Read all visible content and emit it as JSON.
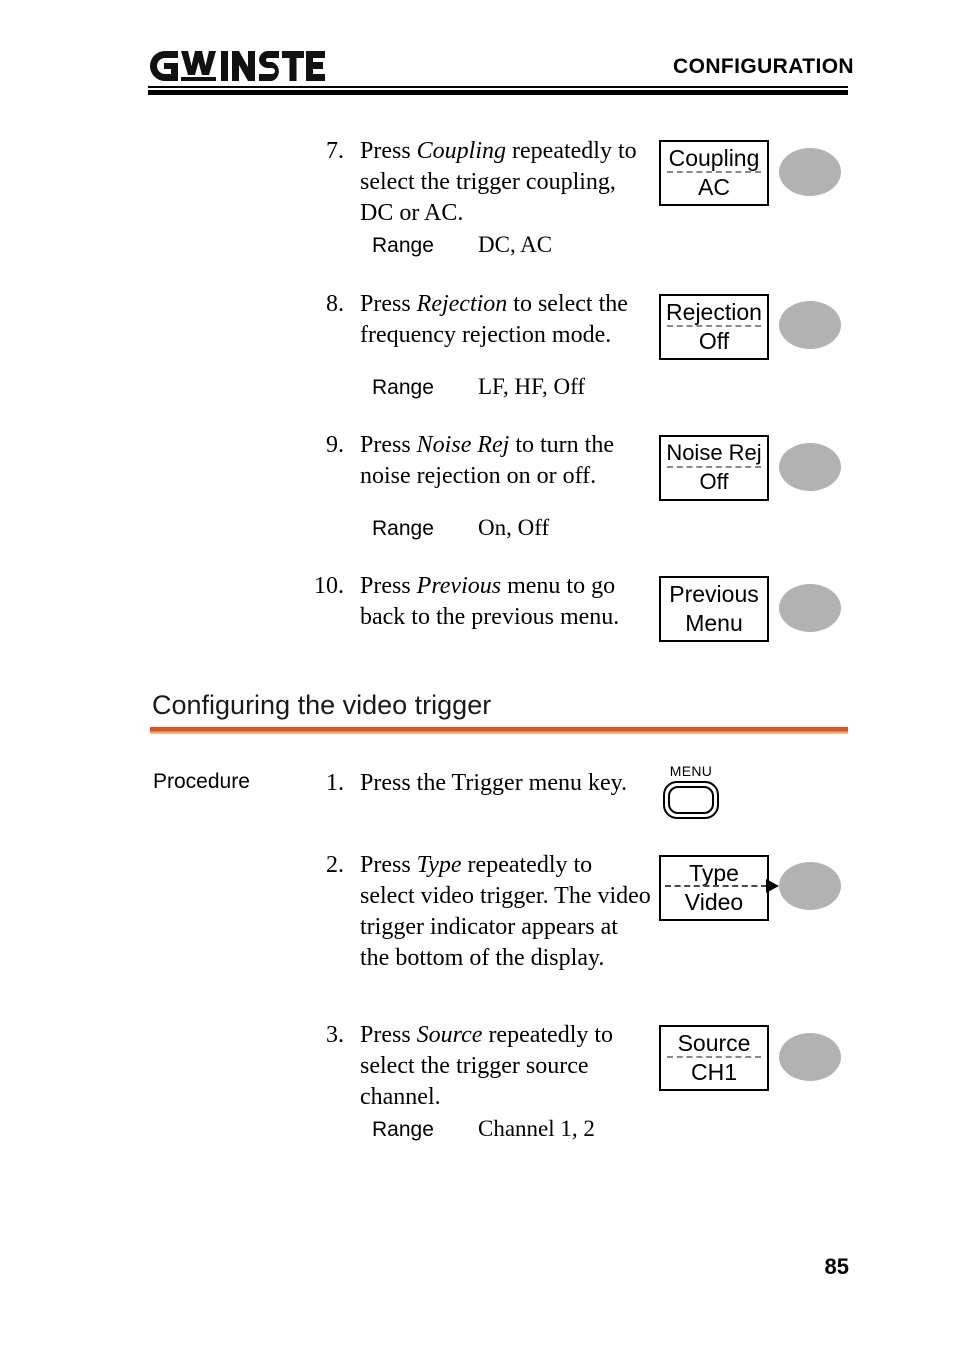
{
  "header": {
    "logo_text": "GW INSTEK",
    "title": "CONFIGURATION"
  },
  "steps": [
    {
      "number": "7.",
      "text_parts": [
        "Press ",
        "Coupling",
        " repeatedly to select the trigger coupling, DC or AC."
      ],
      "range_label": "Range",
      "range_value": "DC, AC",
      "softkey": {
        "top": "Coupling",
        "bottom": "AC",
        "separator": "dotted"
      }
    },
    {
      "number": "8.",
      "text_parts": [
        "Press ",
        "Rejection",
        " to select the frequency rejection mode."
      ],
      "range_label": "Range",
      "range_value": "LF, HF, Off",
      "softkey": {
        "top": "Rejection",
        "bottom": "Off",
        "separator": "dotted"
      }
    },
    {
      "number": "9.",
      "text_parts": [
        "Press ",
        "Noise Rej",
        " to turn the noise rejection on or off."
      ],
      "range_label": "Range",
      "range_value": "On, Off",
      "softkey": {
        "top": "Noise Rej",
        "bottom": "Off",
        "separator": "dotted"
      }
    },
    {
      "number": "10.",
      "text_parts": [
        "Press ",
        "Previous",
        " menu to go back to the previous menu."
      ],
      "range_label": "",
      "range_value": "",
      "softkey": {
        "top": "Previous",
        "bottom": "Menu",
        "separator": "none"
      }
    }
  ],
  "section": {
    "heading": "Configuring the video trigger",
    "procedure_label": "Procedure",
    "accent_color": "#d9522a"
  },
  "video_steps": [
    {
      "number": "1.",
      "text_parts": [
        "Press the Trigger menu key.",
        "",
        ""
      ],
      "range_label": "",
      "range_value": "",
      "menu_key_label": "MENU"
    },
    {
      "number": "2.",
      "text_parts": [
        "Press ",
        "Type",
        " repeatedly to select video trigger. The video trigger indicator appears at the bottom of the display."
      ],
      "range_label": "",
      "range_value": "",
      "softkey": {
        "top": "Type",
        "bottom": "Video",
        "separator": "arrow"
      }
    },
    {
      "number": "3.",
      "text_parts": [
        "Press ",
        "Source",
        " repeatedly to select the trigger source channel."
      ],
      "range_label": "Range",
      "range_value": "Channel 1, 2",
      "softkey": {
        "top": "Source",
        "bottom": "CH1",
        "separator": "dotted"
      }
    }
  ],
  "footer": {
    "page_number": "85"
  }
}
